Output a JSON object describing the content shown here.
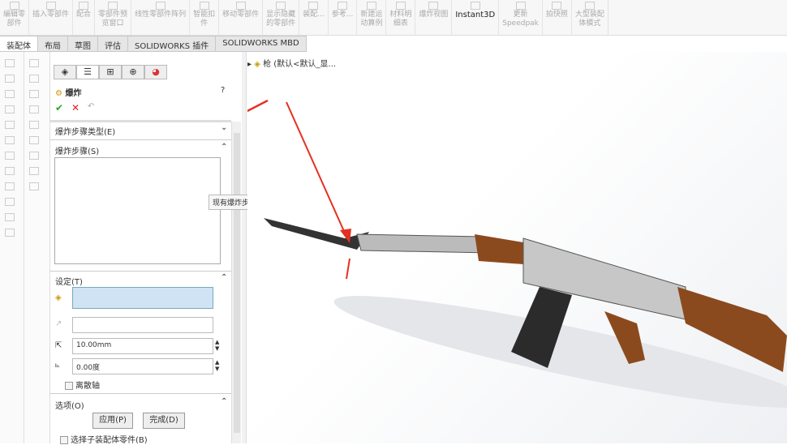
{
  "toolbar": {
    "items": [
      {
        "label": "编辑零\n部件"
      },
      {
        "label": "插入零部件"
      },
      {
        "label": "配合"
      },
      {
        "label": "零部件预\n览窗口"
      },
      {
        "label": "线性零部件阵列"
      },
      {
        "label": "智能扣\n件"
      },
      {
        "label": "移动零部件"
      },
      {
        "label": "显示隐藏\n的零部件"
      },
      {
        "label": "装配..."
      },
      {
        "label": "参考..."
      },
      {
        "label": "新建运\n动算例"
      },
      {
        "label": "材料明\n细表"
      },
      {
        "label": "爆炸视图"
      },
      {
        "label": "Instant3D"
      },
      {
        "label": "更新\nSpeedpak"
      },
      {
        "label": "拍快照"
      },
      {
        "label": "大型装配\n体模式"
      }
    ]
  },
  "tabs": [
    "装配体",
    "布局",
    "草图",
    "评估",
    "SOLIDWORKS 插件",
    "SOLIDWORKS MBD"
  ],
  "panel": {
    "title": "爆炸",
    "help": "?",
    "ok": "✔",
    "cancel": "✕",
    "sections": {
      "type": "爆炸步骤类型(E)",
      "steps": "爆炸步骤(S)",
      "settings": "设定(T)",
      "options": "选项(O)"
    },
    "distance": "10.00mm",
    "angle": "0.00度",
    "explode_axis": "离散轴",
    "apply": "应用(P)",
    "done": "完成(D)",
    "select_sub": "选择子装配体零件(B)"
  },
  "tooltip": "现有爆炸步骤",
  "tree": {
    "root": "枪 (默认<默认_显..."
  },
  "colors": {
    "accent": "#cfe3f5",
    "arrow": "#e53020",
    "wood": "#8b4a1e",
    "metal": "#b8b8b8"
  }
}
